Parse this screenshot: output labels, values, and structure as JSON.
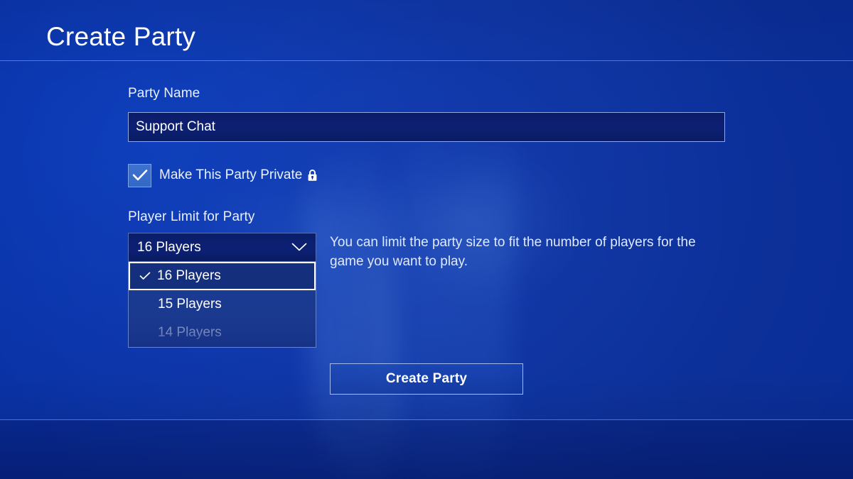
{
  "header": {
    "title": "Create Party"
  },
  "form": {
    "party_name_label": "Party Name",
    "party_name_value": "Support Chat",
    "party_name_placeholder": "Party Name",
    "private_checkbox_label": "Make This Party Private",
    "private_checkbox_checked": "true",
    "lock_icon_name": "lock-icon",
    "player_limit_label": "Player Limit for Party",
    "player_limit_selected": "16 Players",
    "player_limit_options": [
      {
        "label": "16 Players",
        "selected": "true",
        "dimmed": "false"
      },
      {
        "label": "15 Players",
        "selected": "false",
        "dimmed": "false"
      },
      {
        "label": "14 Players",
        "selected": "false",
        "dimmed": "true"
      }
    ],
    "help_text": "You can limit the party size to fit the number of players for the game you want to play."
  },
  "actions": {
    "create_party_label": "Create Party"
  },
  "colors": {
    "background_blue": "#0a35ab",
    "input_navy": "#0c2073",
    "menu_navy": "#1a3a90",
    "checkbox_blue": "#3468c6",
    "border_light": "#b2caff",
    "text_white": "#ffffff"
  }
}
